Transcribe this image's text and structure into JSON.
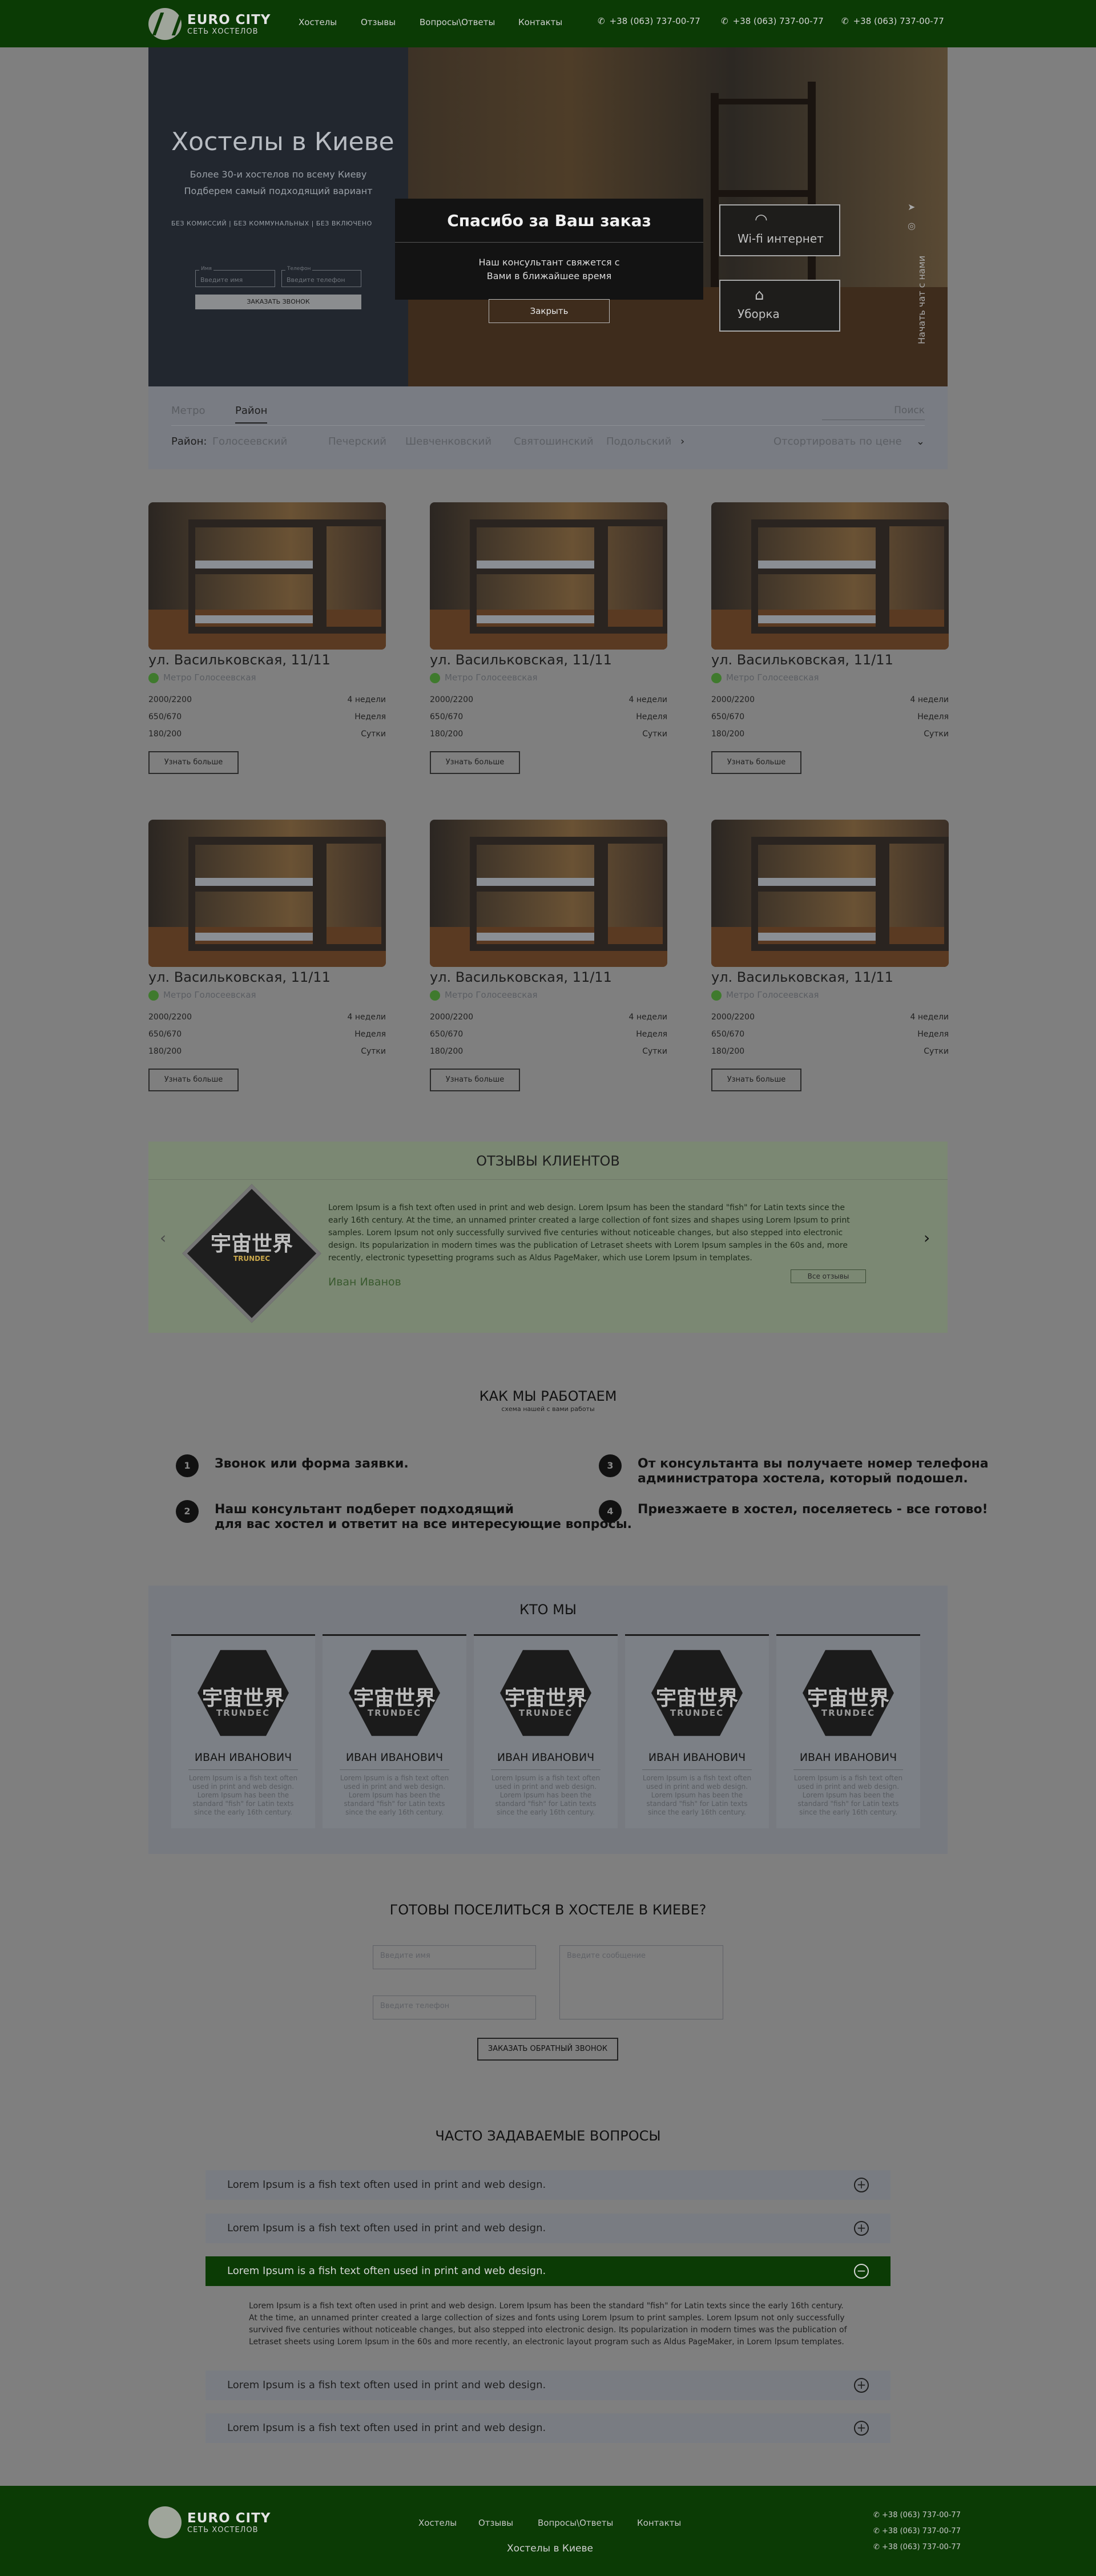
{
  "header": {
    "logo_title": "EURO CITY",
    "logo_subtitle": "СЕТЬ ХОСТЕЛОВ",
    "nav": [
      "Хостелы",
      "Отзывы",
      "Вопросы\\Ответы",
      "Контакты"
    ],
    "phones": [
      "+38 (063) 737-00-77",
      "+38 (063) 737-00-77",
      "+38 (063) 737-00-77"
    ],
    "phone_icon": "phone-icon"
  },
  "hero": {
    "title": "Хостелы в Киеве",
    "subtitle1": "Более 30-и хостелов по всему Киеву",
    "subtitle2": "Подберем самый подходящий вариант",
    "tags": "БЕЗ КОМИССИЙ   |   БЕЗ КОММУНАЛЬНЫХ   |   БЕЗ ВКЛЮЧЕНО",
    "name_label": "Имя",
    "name_placeholder": "Введите имя",
    "phone_label": "Телефон",
    "phone_placeholder": "Введите телефон",
    "button": "ЗАКАЗАТЬ ЗВОНОК",
    "features": [
      {
        "label": "Wi-fi интернет",
        "icon": "wifi-icon"
      },
      {
        "label": "Уборка",
        "icon": "cleaning-icon"
      }
    ],
    "vertical_text": "Начать чат с нами",
    "social_icons": [
      "telegram-icon",
      "viber-icon"
    ]
  },
  "modal": {
    "title": "Спасибо за Ваш заказ",
    "text1": "Наш консультант свяжется с",
    "text2": "Вами в ближайшее время",
    "button": "Закрыть"
  },
  "filter": {
    "tabs": [
      "Метро",
      "Район"
    ],
    "active_tab": "Район",
    "search_placeholder": "Поиск",
    "district_label": "Район:",
    "districts": [
      "Голосеевский",
      "Печерский",
      "Шевченковский",
      "Святошинский",
      "Подольский"
    ],
    "sort": "Отсортировать по цене"
  },
  "cards": [
    {
      "address": "ул. Васильковская, 11/11",
      "metro": "Метро Голосеевская",
      "prices": [
        {
          "price": "2000/2200",
          "period": "4 недели"
        },
        {
          "price": "650/670",
          "period": "Неделя"
        },
        {
          "price": "180/200",
          "period": "Сутки"
        }
      ],
      "button": "Узнать больше"
    },
    {
      "address": "ул. Васильковская, 11/11",
      "metro": "Метро Голосеевская",
      "prices": [
        {
          "price": "2000/2200",
          "period": "4 недели"
        },
        {
          "price": "650/670",
          "period": "Неделя"
        },
        {
          "price": "180/200",
          "period": "Сутки"
        }
      ],
      "button": "Узнать больше"
    },
    {
      "address": "ул. Васильковская, 11/11",
      "metro": "Метро Голосеевская",
      "prices": [
        {
          "price": "2000/2200",
          "period": "4 недели"
        },
        {
          "price": "650/670",
          "period": "Неделя"
        },
        {
          "price": "180/200",
          "period": "Сутки"
        }
      ],
      "button": "Узнать больше"
    },
    {
      "address": "ул. Васильковская, 11/11",
      "metro": "Метро Голосеевская",
      "prices": [
        {
          "price": "2000/2200",
          "period": "4 недели"
        },
        {
          "price": "650/670",
          "period": "Неделя"
        },
        {
          "price": "180/200",
          "period": "Сутки"
        }
      ],
      "button": "Узнать больше"
    },
    {
      "address": "ул. Васильковская, 11/11",
      "metro": "Метро Голосеевская",
      "prices": [
        {
          "price": "2000/2200",
          "period": "4 недели"
        },
        {
          "price": "650/670",
          "period": "Неделя"
        },
        {
          "price": "180/200",
          "period": "Сутки"
        }
      ],
      "button": "Узнать больше"
    },
    {
      "address": "ул. Васильковская, 11/11",
      "metro": "Метро Голосеевская",
      "prices": [
        {
          "price": "2000/2200",
          "period": "4 недели"
        },
        {
          "price": "650/670",
          "period": "Неделя"
        },
        {
          "price": "180/200",
          "period": "Сутки"
        }
      ],
      "button": "Узнать больше"
    }
  ],
  "reviews": {
    "title": "ОТЗЫВЫ КЛИЕНТОВ",
    "logo_text": "宇宙世界",
    "logo_sub": "TRUNDEC",
    "text": "Lorem Ipsum is a fish text often used in print and web design. Lorem Ipsum has been the standard \"fish\" for Latin texts since the early 16th century. At the time, an unnamed printer created a large collection of font sizes and shapes using Lorem Ipsum to print samples. Lorem Ipsum not only successfully survived five centuries without noticeable changes, but also stepped into electronic design. Its popularization in modern times was the publication of Letraset sheets with Lorem Ipsum samples in the 60s and, more recently, electronic typesetting programs such as Aldus PageMaker, which use Lorem Ipsum in templates.",
    "author": "Иван Иванов",
    "all_button": "Все отзывы",
    "prev_icon": "chevron-left-icon",
    "next_icon": "chevron-right-icon"
  },
  "how": {
    "title": "КАК МЫ РАБОТАЕМ",
    "subtitle": "схема нашей с вами работы",
    "steps": [
      {
        "num": "1",
        "text1": "Звонок или форма заявки.",
        "text2": ""
      },
      {
        "num": "2",
        "text1": "Наш консультант подберет подходящий",
        "text2": "для вас хостел и ответит на все интересующие вопросы."
      },
      {
        "num": "3",
        "text1": "От консультанта вы получаете номер телефона",
        "text2": "администратора хостела, который подошел."
      },
      {
        "num": "4",
        "text1": "Приезжаете в хостел, поселяетесь - все готово!",
        "text2": ""
      }
    ]
  },
  "team": {
    "title": "КТО МЫ",
    "logo_text": "宇宙世界",
    "logo_sub": "TRUNDEC",
    "members": [
      {
        "name": "ИВАН ИВАНОВИЧ",
        "desc": "Lorem Ipsum is a fish text often used in print and web design. Lorem Ipsum has been the standard \"fish\" for Latin texts since the early 16th century."
      },
      {
        "name": "ИВАН ИВАНОВИЧ",
        "desc": "Lorem Ipsum is a fish text often used in print and web design. Lorem Ipsum has been the standard \"fish\" for Latin texts since the early 16th century."
      },
      {
        "name": "ИВАН ИВАНОВИЧ",
        "desc": "Lorem Ipsum is a fish text often used in print and web design. Lorem Ipsum has been the standard \"fish\" for Latin texts since the early 16th century."
      },
      {
        "name": "ИВАН ИВАНОВИЧ",
        "desc": "Lorem Ipsum is a fish text often used in print and web design. Lorem Ipsum has been the standard \"fish\" for Latin texts since the early 16th century."
      },
      {
        "name": "ИВАН ИВАНОВИЧ",
        "desc": "Lorem Ipsum is a fish text often used in print and web design. Lorem Ipsum has been the standard \"fish\" for Latin texts since the early 16th century."
      }
    ]
  },
  "contact": {
    "title": "ГОТОВЫ ПОСЕЛИТЬСЯ В ХОСТЕЛЕ В КИЕВЕ?",
    "name_placeholder": "Введите имя",
    "phone_placeholder": "Введите телефон",
    "message_placeholder": "Введите сообщение",
    "button": "ЗАКАЗАТЬ ОБРАТНЫЙ ЗВОНОК"
  },
  "faq": {
    "title": "ЧАСТО ЗАДАВАЕМЫЕ ВОПРОСЫ",
    "questions": [
      "Lorem Ipsum is a fish text often used in print and web design.",
      "Lorem Ipsum is a fish text often used in print and web design.",
      "Lorem Ipsum is a fish text often used in print and web design.",
      "Lorem Ipsum is a fish text often used in print and web design.",
      "Lorem Ipsum is a fish text often used in print and web design."
    ],
    "open_index": 2,
    "answer": "Lorem Ipsum is a fish text often used in print and web design. Lorem Ipsum has been the standard \"fish\" for Latin texts since the early 16th century. At the time, an unnamed printer created a large collection of sizes and fonts using Lorem Ipsum to print samples. Lorem Ipsum not only successfully survived five centuries without noticeable changes, but also stepped into electronic design. Its popularization in modern times was the publication of Letraset sheets using Lorem Ipsum in the 60s and more recently, an electronic layout program such as Aldus PageMaker, in Lorem Ipsum templates.",
    "plus": "+",
    "minus": "−"
  },
  "footer": {
    "nav": [
      "Хостелы",
      "Отзывы",
      "Вопросы\\Ответы",
      "Контакты"
    ],
    "city": "Хостелы в Киеве",
    "phones": [
      "+38 (063) 737-00-77",
      "+38 (063) 737-00-77",
      "+38 (063) 737-00-77"
    ]
  },
  "colors": {
    "brand_green": "#0b3b05",
    "overlay": "#7f7f7f"
  }
}
